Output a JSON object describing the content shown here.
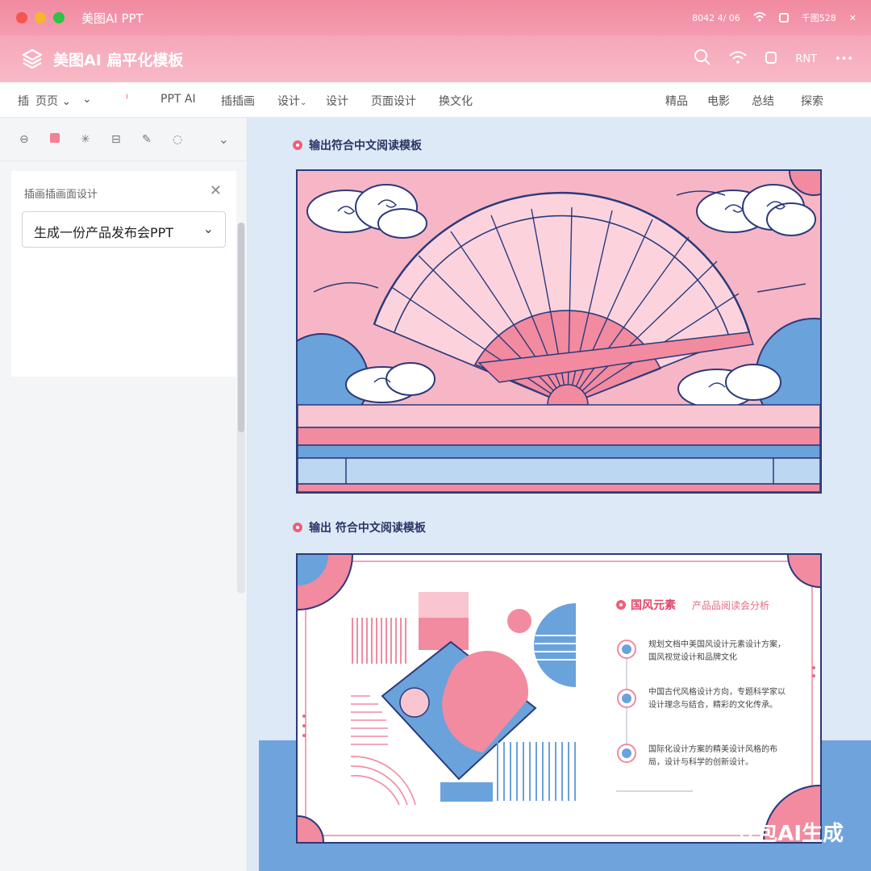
{
  "window": {
    "title": "美图AI PPT",
    "status_time": "8042 4/ 06",
    "status_right": "千图528"
  },
  "appbar": {
    "name": "美图AI 扁平化模板",
    "right_label": "RNT"
  },
  "menu": {
    "items": [
      "插",
      "页页",
      "PPT AI",
      "插插画",
      "设计",
      "设计",
      "页面设计",
      "换文化",
      "精品",
      "电影",
      "总结",
      "探索"
    ]
  },
  "sidebar": {
    "panel_title": "插画插画面设计",
    "selected_prompt": "生成一份产品发布会PPT"
  },
  "slides": [
    {
      "title": "输出符合中文阅读模板"
    },
    {
      "title": "输出 符合中文阅读模板",
      "heading": "国风元素",
      "subheading": "产品品阅读会分析",
      "bullets": [
        "规划文档中美国风设计元素设计方案，国风视觉设计和品牌文化",
        "中国古代风格设计方向，专题科学家以设计理念与结合，精彩的文化传承。",
        "国际化设计方案的精美设计风格的布局，设计与科学的创新设计。"
      ]
    }
  ],
  "watermark": "豆包AI生成",
  "colors": {
    "pink": "#f4a3b4",
    "rose": "#ee5f7a",
    "navy": "#2b3a7a",
    "blue": "#6fa3dc",
    "light_blue": "#bcd7f2"
  }
}
